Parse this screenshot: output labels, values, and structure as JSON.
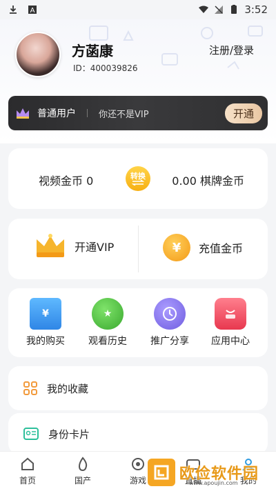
{
  "status_bar": {
    "time": "3:52",
    "icons": [
      "download-icon",
      "a-icon",
      "wifi-icon",
      "no-signal-icon",
      "battery-icon"
    ]
  },
  "profile": {
    "name": "方菡康",
    "id": "ID：400039826",
    "login": "注册/登录"
  },
  "vip_bar": {
    "level": "普通用户",
    "hint": "你还不是VIP",
    "button": "开通"
  },
  "coins": {
    "video": "视频金币 0",
    "swap": "转换",
    "chess": "0.00 棋牌金币"
  },
  "vip_row": {
    "open_vip": "开通VIP",
    "recharge": "充值金币"
  },
  "tools": [
    {
      "label": "我的购买",
      "icon": "purchase-icon",
      "color": "#4aa3f3"
    },
    {
      "label": "观看历史",
      "icon": "star-history-icon",
      "color": "#5ac84b"
    },
    {
      "label": "推广分享",
      "icon": "clock-share-icon",
      "color": "#8f7ff0"
    },
    {
      "label": "应用中心",
      "icon": "app-center-icon",
      "color": "#f2566c"
    }
  ],
  "list": {
    "favorites": "我的收藏",
    "idcard": "身份卡片"
  },
  "nav": [
    {
      "label": "首页",
      "icon": "home-icon"
    },
    {
      "label": "国产",
      "icon": "flame-icon"
    },
    {
      "label": "游戏",
      "icon": "game-icon"
    },
    {
      "label": "直播",
      "icon": "live-icon"
    },
    {
      "label": "我的",
      "icon": "profile-icon"
    }
  ],
  "watermark": {
    "text": "欧俭软件园",
    "url": "www.apoujin.com"
  },
  "colors": {
    "accent": "#f7b013",
    "vip_bg": "#2b2b2d"
  }
}
